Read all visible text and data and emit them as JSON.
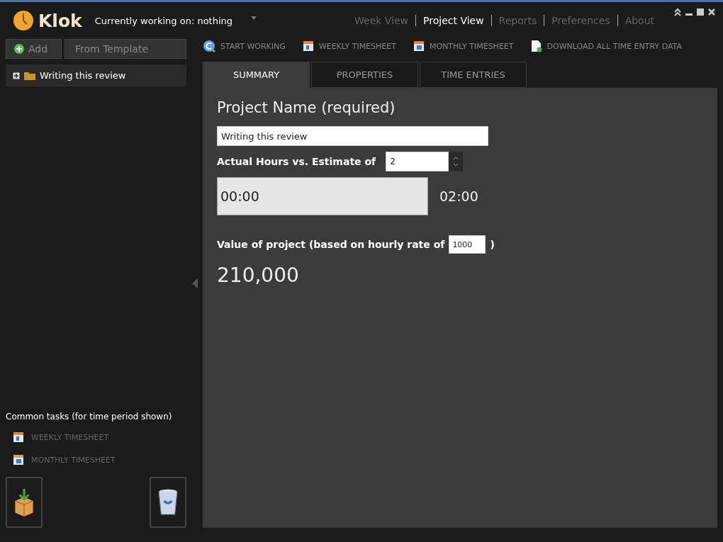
{
  "app": {
    "name": "Klok",
    "status": "Currently working on: nothing"
  },
  "nav": [
    {
      "label": "Week View",
      "selected": false
    },
    {
      "label": "Project View",
      "selected": true
    },
    {
      "label": "Reports",
      "selected": false
    },
    {
      "label": "Preferences",
      "selected": false
    },
    {
      "label": "About",
      "selected": false
    }
  ],
  "sidebar": {
    "buttons": [
      {
        "kind": "add",
        "label": "Add"
      },
      {
        "kind": "plain",
        "label": "From Template"
      }
    ],
    "tree": [
      {
        "label": "Writing this review",
        "expanded": false
      }
    ],
    "common_tasks_title": "Common tasks (for time period shown)",
    "common_tasks": [
      {
        "kind": "weekly",
        "label": "WEEKLY TIMESHEET"
      },
      {
        "kind": "monthly",
        "label": "MONTHLY TIMESHEET"
      }
    ]
  },
  "toolbar": [
    {
      "kind": "start",
      "label": "START WORKING"
    },
    {
      "kind": "weekly",
      "label": "WEEKLY TIMESHEET"
    },
    {
      "kind": "monthly",
      "label": "MONTHLY TIMESHEET"
    },
    {
      "kind": "download",
      "label": "DOWNLOAD ALL TIME ENTRY DATA"
    }
  ],
  "tabs": [
    {
      "label": "SUMMARY",
      "selected": true
    },
    {
      "label": "PROPERTIES",
      "selected": false
    },
    {
      "label": "TIME ENTRIES",
      "selected": false
    }
  ],
  "summary": {
    "name_label": "Project Name (required)",
    "name_value": "Writing this review",
    "estimate_label": "Actual Hours vs. Estimate of",
    "estimate_value": "2",
    "actual": "00:00",
    "estimate_time": "02:00",
    "value_label": "Value of project (based on hourly rate of",
    "rate_value": "1000",
    "value_close": ")",
    "value": "210,000"
  }
}
